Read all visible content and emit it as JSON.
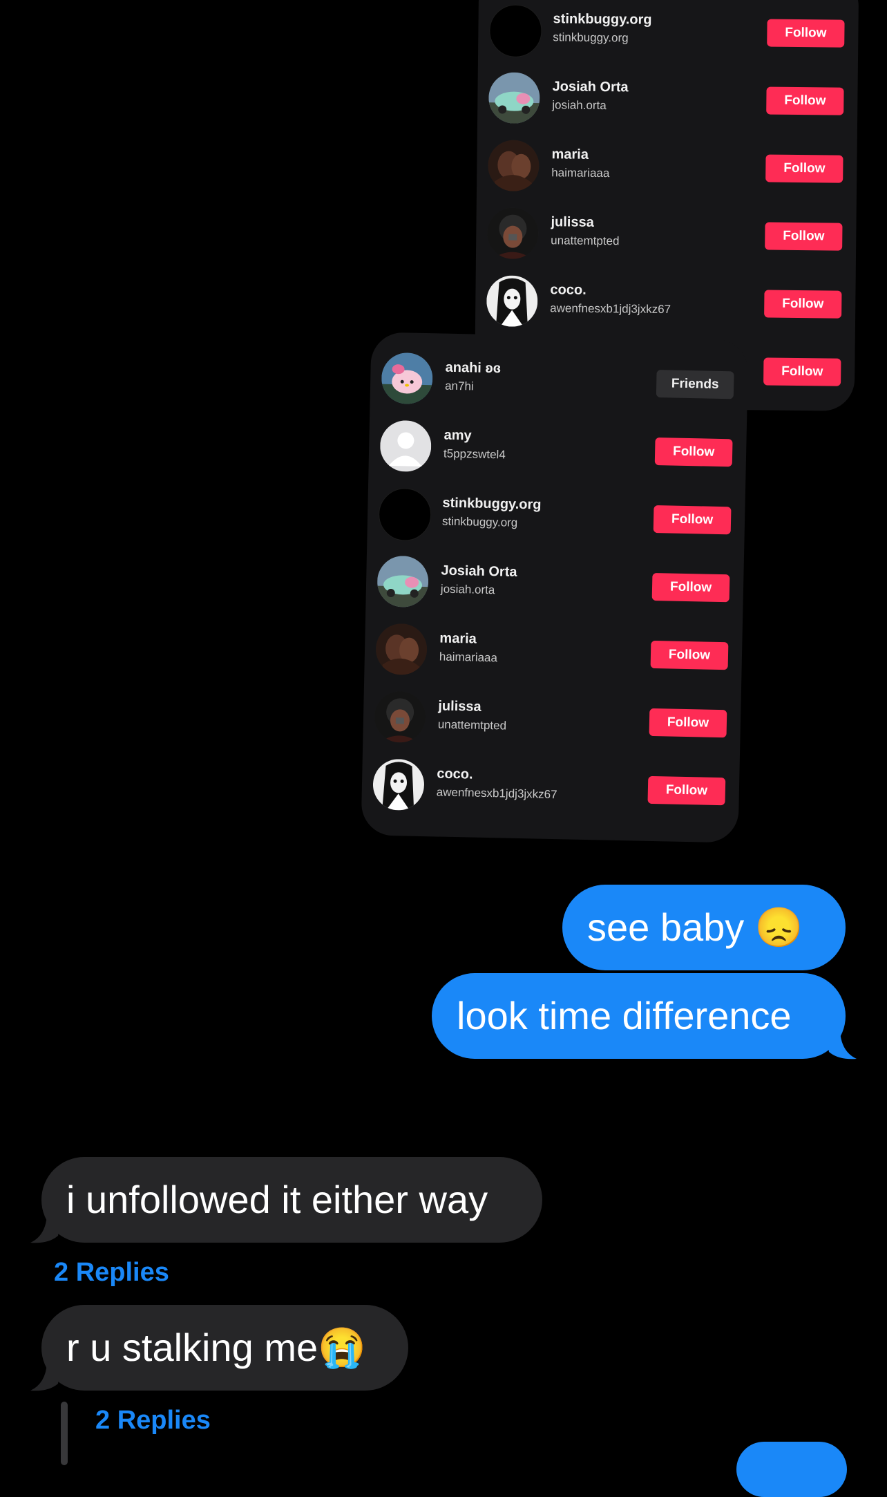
{
  "top_card": {
    "rows": [
      {
        "display": "stinkbuggy.org",
        "handle": "stinkbuggy.org",
        "button": "Follow"
      },
      {
        "display": "Josiah Orta",
        "handle": "josiah.orta",
        "button": "Follow"
      },
      {
        "display": "maria",
        "handle": "haimariaaa",
        "button": "Follow"
      },
      {
        "display": "julissa",
        "handle": "unattemtpted",
        "button": "Follow"
      },
      {
        "display": "coco.",
        "handle": "awenfnesxb1jdj3jxkz67",
        "button": "Follow"
      },
      {
        "display": "",
        "handle": "",
        "button": "Follow"
      }
    ]
  },
  "front_card": {
    "rows": [
      {
        "display": "anahi ʚɞ",
        "handle": "an7hi",
        "button": "Friends"
      },
      {
        "display": "amy",
        "handle": "t5ppzswtel4",
        "button": "Follow"
      },
      {
        "display": "stinkbuggy.org",
        "handle": "stinkbuggy.org",
        "button": "Follow"
      },
      {
        "display": "Josiah Orta",
        "handle": "josiah.orta",
        "button": "Follow"
      },
      {
        "display": "maria",
        "handle": "haimariaaa",
        "button": "Follow"
      },
      {
        "display": "julissa",
        "handle": "unattemtpted",
        "button": "Follow"
      },
      {
        "display": "coco.",
        "handle": "awenfnesxb1jdj3jxkz67",
        "button": "Follow"
      }
    ]
  },
  "messages": {
    "sent_1": "see baby 😞",
    "sent_2": "look time difference",
    "recv_1": "i unfollowed it either way",
    "recv_1_replies": "2 Replies",
    "recv_2": "r u stalking me😭",
    "recv_2_replies": "2 Replies"
  },
  "colors": {
    "follow": "#fe2c55",
    "sent_bubble": "#1a88f8",
    "received_bubble": "#262628",
    "card": "#161618"
  }
}
